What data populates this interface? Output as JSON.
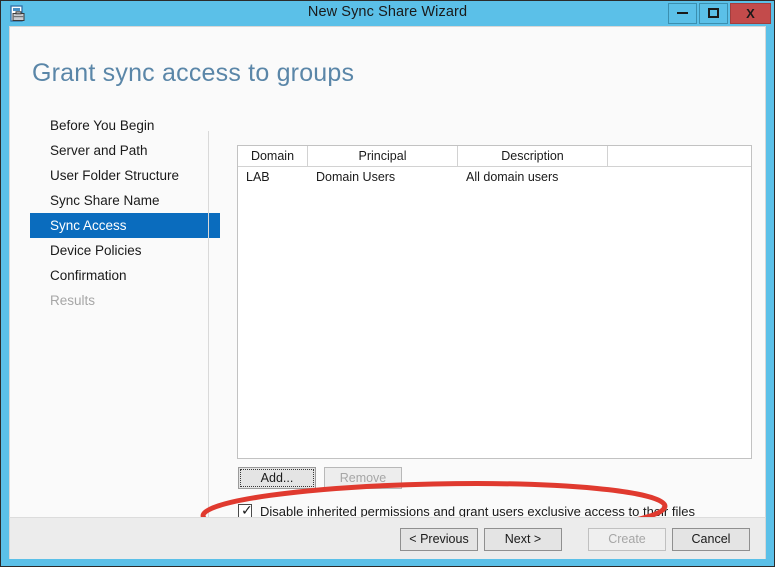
{
  "window": {
    "title": "New Sync Share Wizard",
    "icon": "sync-share-wizard-icon",
    "accent_color": "#5BC0E8",
    "controls": {
      "minimize_label": "",
      "maximize_label": "",
      "close_label": "X"
    }
  },
  "page": {
    "title": "Grant sync access to groups",
    "title_color": "#5a86a8"
  },
  "sidebar": {
    "items": [
      {
        "label": "Before You Begin",
        "state": "normal"
      },
      {
        "label": "Server and Path",
        "state": "normal"
      },
      {
        "label": "User Folder Structure",
        "state": "normal"
      },
      {
        "label": "Sync Share Name",
        "state": "normal"
      },
      {
        "label": "Sync Access",
        "state": "selected"
      },
      {
        "label": "Device Policies",
        "state": "normal"
      },
      {
        "label": "Confirmation",
        "state": "normal"
      },
      {
        "label": "Results",
        "state": "disabled"
      }
    ],
    "selected_color": "#0A6CBE"
  },
  "table": {
    "columns": [
      "Domain",
      "Principal",
      "Description",
      ""
    ],
    "rows": [
      {
        "domain": "LAB",
        "principal": "Domain Users",
        "description": "All domain users"
      }
    ]
  },
  "list_actions": {
    "add_label": "Add...",
    "remove_label": "Remove",
    "remove_enabled": false
  },
  "options": {
    "disable_inherited": {
      "label": "Disable inherited permissions and grant users exclusive access to their files",
      "checked": true,
      "check_glyph": "✓"
    }
  },
  "annotation": {
    "shape": "ellipse",
    "color": "#E03A2F",
    "target": "disable-inherited-permissions-checkbox"
  },
  "footer": {
    "previous_label": "< Previous",
    "next_label": "Next >",
    "create_label": "Create",
    "create_enabled": false,
    "cancel_label": "Cancel"
  }
}
